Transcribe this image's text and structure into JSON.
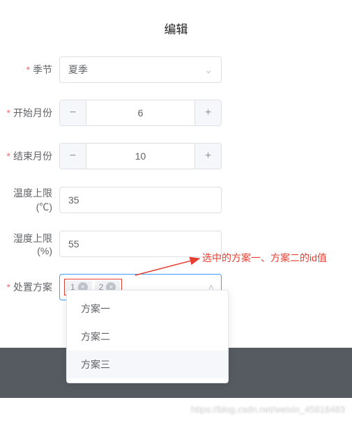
{
  "title": "编辑",
  "fields": {
    "season": {
      "label": "季节",
      "value": "夏季"
    },
    "startMonth": {
      "label": "开始月份",
      "value": "6"
    },
    "endMonth": {
      "label": "结束月份",
      "value": "10"
    },
    "tempLimit": {
      "label": "温度上限(℃)",
      "value": "35"
    },
    "humidityLimit": {
      "label": "湿度上限(%)",
      "value": "55"
    },
    "plan": {
      "label": "处置方案",
      "tags": [
        "1",
        "2"
      ]
    }
  },
  "dropdown": {
    "options": [
      "方案一",
      "方案二",
      "方案三"
    ]
  },
  "annotation": "选中的方案一、方案二的id值",
  "watermark": "https://blog.csdn.net/weixin_45616483",
  "glyphs": {
    "minus": "−",
    "plus": "+",
    "down": "⌄",
    "up": "˄",
    "close": "×"
  }
}
